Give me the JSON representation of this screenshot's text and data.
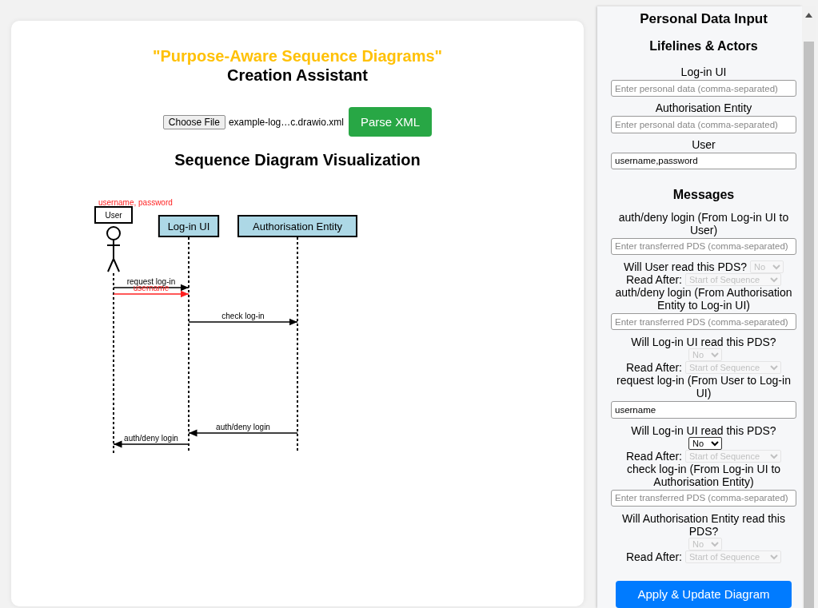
{
  "header": {
    "title": "\"Purpose-Aware Sequence Diagrams\"",
    "subtitle": "Creation Assistant"
  },
  "file_picker": {
    "button": "Choose File",
    "filename": "example-log…c.drawio.xml"
  },
  "parse_button": "Parse XML",
  "visualization": {
    "title": "Sequence Diagram Visualization",
    "lifelines": [
      {
        "name": "User",
        "kind": "actor",
        "pds": "username, password"
      },
      {
        "name": "Log-in UI",
        "kind": "box"
      },
      {
        "name": "Authorisation Entity",
        "kind": "box"
      }
    ],
    "messages": [
      {
        "label": "request log-in",
        "kind": "message"
      },
      {
        "label": "username",
        "kind": "pds"
      },
      {
        "label": "check log-in",
        "kind": "message"
      },
      {
        "label": "auth/deny login",
        "kind": "message"
      },
      {
        "label": "auth/deny login",
        "kind": "message"
      }
    ]
  },
  "panel": {
    "title": "Personal Data Input",
    "lifelines_title": "Lifelines & Actors",
    "lifelines": [
      {
        "label": "Log-in UI",
        "placeholder": "Enter personal data (comma-separated)"
      },
      {
        "label": "Authorisation Entity",
        "placeholder": "Enter personal data (comma-separated)"
      },
      {
        "label": "User",
        "value": "username,password"
      }
    ],
    "messages_title": "Messages",
    "messages": [
      {
        "title": "auth/deny login (From Log-in UI to User)",
        "placeholder": "Enter transferred PDS (comma-separated)",
        "question": "Will User read this PDS?",
        "read": {
          "value": "No",
          "disabled": true
        },
        "read_after_label": "Read After:",
        "read_after": {
          "value": "Start of Sequence",
          "disabled": true
        }
      },
      {
        "title": "auth/deny login (From Authorisation Entity to Log-in UI)",
        "placeholder": "Enter transferred PDS (comma-separated)",
        "question": "Will Log-in UI read this PDS?",
        "read": {
          "value": "No",
          "disabled": true
        },
        "read_after_label": "Read After:",
        "read_after": {
          "value": "Start of Sequence",
          "disabled": true
        }
      },
      {
        "title": "request log-in (From User to Log-in UI)",
        "value": "username",
        "question": "Will Log-in UI read this PDS?",
        "read": {
          "value": "No",
          "disabled": false
        },
        "read_after_label": "Read After:",
        "read_after": {
          "value": "Start of Sequence",
          "disabled": true
        }
      },
      {
        "title": "check log-in (From Log-in UI to Authorisation Entity)",
        "placeholder": "Enter transferred PDS (comma-separated)",
        "question": "Will Authorisation Entity read this PDS?",
        "read": {
          "value": "No",
          "disabled": true
        },
        "read_after_label": "Read After:",
        "read_after": {
          "value": "Start of Sequence",
          "disabled": true
        }
      }
    ],
    "apply_button": "Apply & Update Diagram"
  }
}
